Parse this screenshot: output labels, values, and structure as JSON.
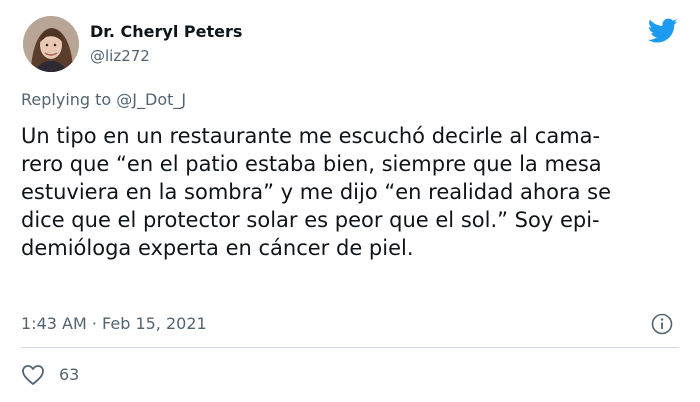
{
  "author": {
    "display_name": "Dr. Cheryl Peters",
    "handle": "@liz272",
    "avatar_icon": "profile-photo"
  },
  "reply_to": {
    "prefix": "Replying to ",
    "handle": "@J_Dot_J"
  },
  "tweet": {
    "lines": [
      "Un tipo en un restaurante me escuchó decirle al cama-",
      "rero que “en el patio estaba bien, siempre que la mesa",
      "estuviera en la sombra” y me dijo “en realidad ahora se",
      "dice que el protector solar es peor que el sol.” Soy epi-",
      "demióloga experta en cáncer de piel."
    ],
    "timestamp": "1:43 AM · Feb 15, 2021"
  },
  "actions": {
    "like_count": "63",
    "like_icon": "heart-icon",
    "info_icon": "info-icon"
  },
  "brand": {
    "logo_icon": "twitter-bird-icon",
    "accent_color": "#1d9bf0"
  }
}
